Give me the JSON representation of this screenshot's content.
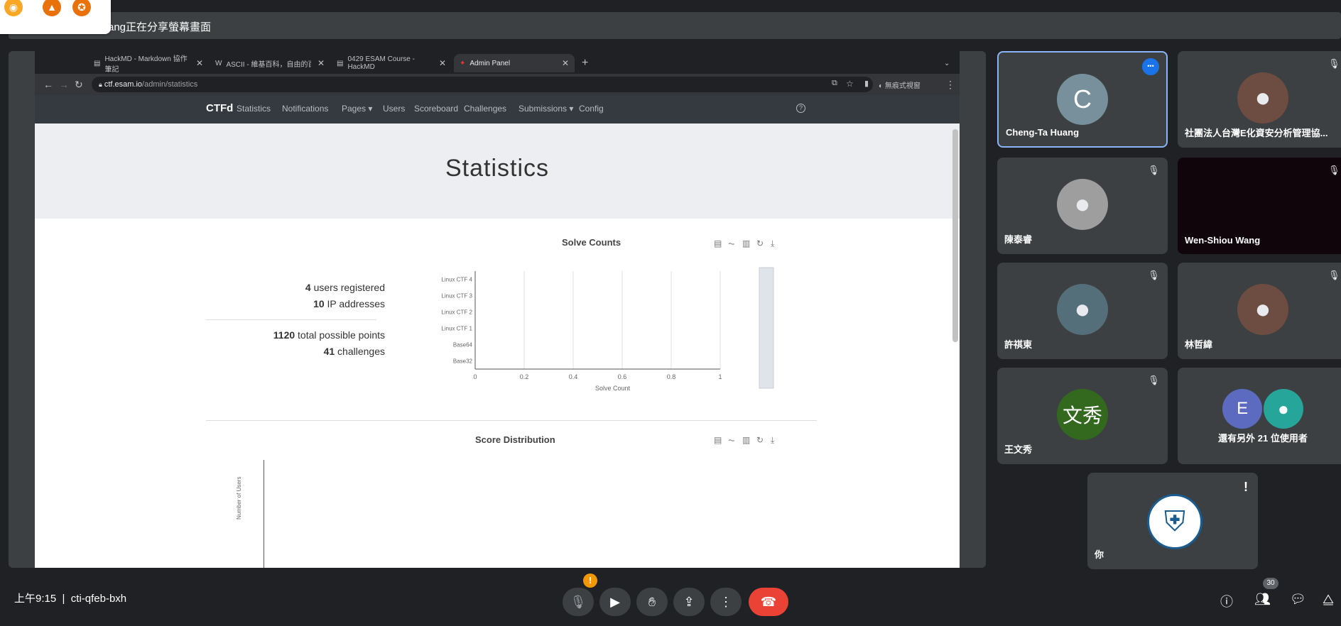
{
  "share_banner": "ang正在分享螢幕畫面",
  "browser": {
    "tabs": [
      {
        "label": "HackMD - Markdown 協作筆記",
        "active": false
      },
      {
        "label": "ASCII - 維基百科，自由的百科全書",
        "active": false
      },
      {
        "label": "0429 ESAM Course - HackMD",
        "active": false
      },
      {
        "label": "Admin Panel",
        "active": true
      }
    ],
    "new_tab": "+",
    "url_host": "ctf.esam.io",
    "url_path": "/admin/statistics",
    "profile_label": "無痕式視窗"
  },
  "ctfd": {
    "brand": "CTFd",
    "nav": [
      "Statistics",
      "Notifications",
      "Pages ▾",
      "Users",
      "Scoreboard",
      "Challenges",
      "Submissions ▾",
      "Config"
    ],
    "page_title": "Statistics",
    "stats": {
      "users_num": "4",
      "users_text": " users registered",
      "ips_num": "10",
      "ips_text": " IP addresses",
      "points_num": "1120",
      "points_text": " total possible points",
      "challenges_num": "41",
      "challenges_text": " challenges"
    },
    "solve_title": "Solve Counts",
    "solve_axis_label": "Solve Count",
    "solve_ticks": [
      "0",
      "0.2",
      "0.4",
      "0.6",
      "0.8",
      "1"
    ],
    "score_title": "Score Distribution",
    "score_ylabel": "Number of Users"
  },
  "chart_data": {
    "type": "bar",
    "title": "Solve Counts",
    "xlabel": "Solve Count",
    "ylabel": "",
    "xlim": [
      0,
      1
    ],
    "orientation": "horizontal",
    "categories": [
      "Linux CTF 4",
      "Linux CTF 3",
      "Linux CTF 2",
      "Linux CTF 1",
      "Base64",
      "Base32"
    ],
    "values": [
      0,
      0,
      0,
      0,
      0,
      0
    ]
  },
  "participants": [
    {
      "name": "Cheng-Ta Huang",
      "initial": "C",
      "color": "#78909c",
      "selected": true,
      "muted": false
    },
    {
      "name": "社團法人台灣E化資安分析管理協...",
      "initial": "",
      "color": "#6d4c41",
      "selected": false,
      "muted": true
    },
    {
      "name": "陳泰睿",
      "initial": "",
      "color": "#9e9e9e",
      "selected": false,
      "muted": true
    },
    {
      "name": "Wen-Shiou Wang",
      "initial": "",
      "color": "#11050c",
      "selected": false,
      "muted": true
    },
    {
      "name": "許祺東",
      "initial": "",
      "color": "#546e7a",
      "selected": false,
      "muted": true
    },
    {
      "name": "林哲緯",
      "initial": "",
      "color": "#6d4c41",
      "selected": false,
      "muted": true
    },
    {
      "name": "王文秀",
      "initial": "文秀",
      "color": "#33691e",
      "selected": false,
      "muted": true
    },
    {
      "name": "還有另外 21 位使用者",
      "initial": "E",
      "color": "#5c6bc0",
      "selected": false,
      "muted": false
    },
    {
      "name": "你",
      "initial": "",
      "color": "#ffffff",
      "selected": false,
      "muted": false
    }
  ],
  "bottom": {
    "time": "上午9:15",
    "meeting_code": "cti-qfeb-bxh",
    "people_count": "30",
    "alert": "!"
  }
}
